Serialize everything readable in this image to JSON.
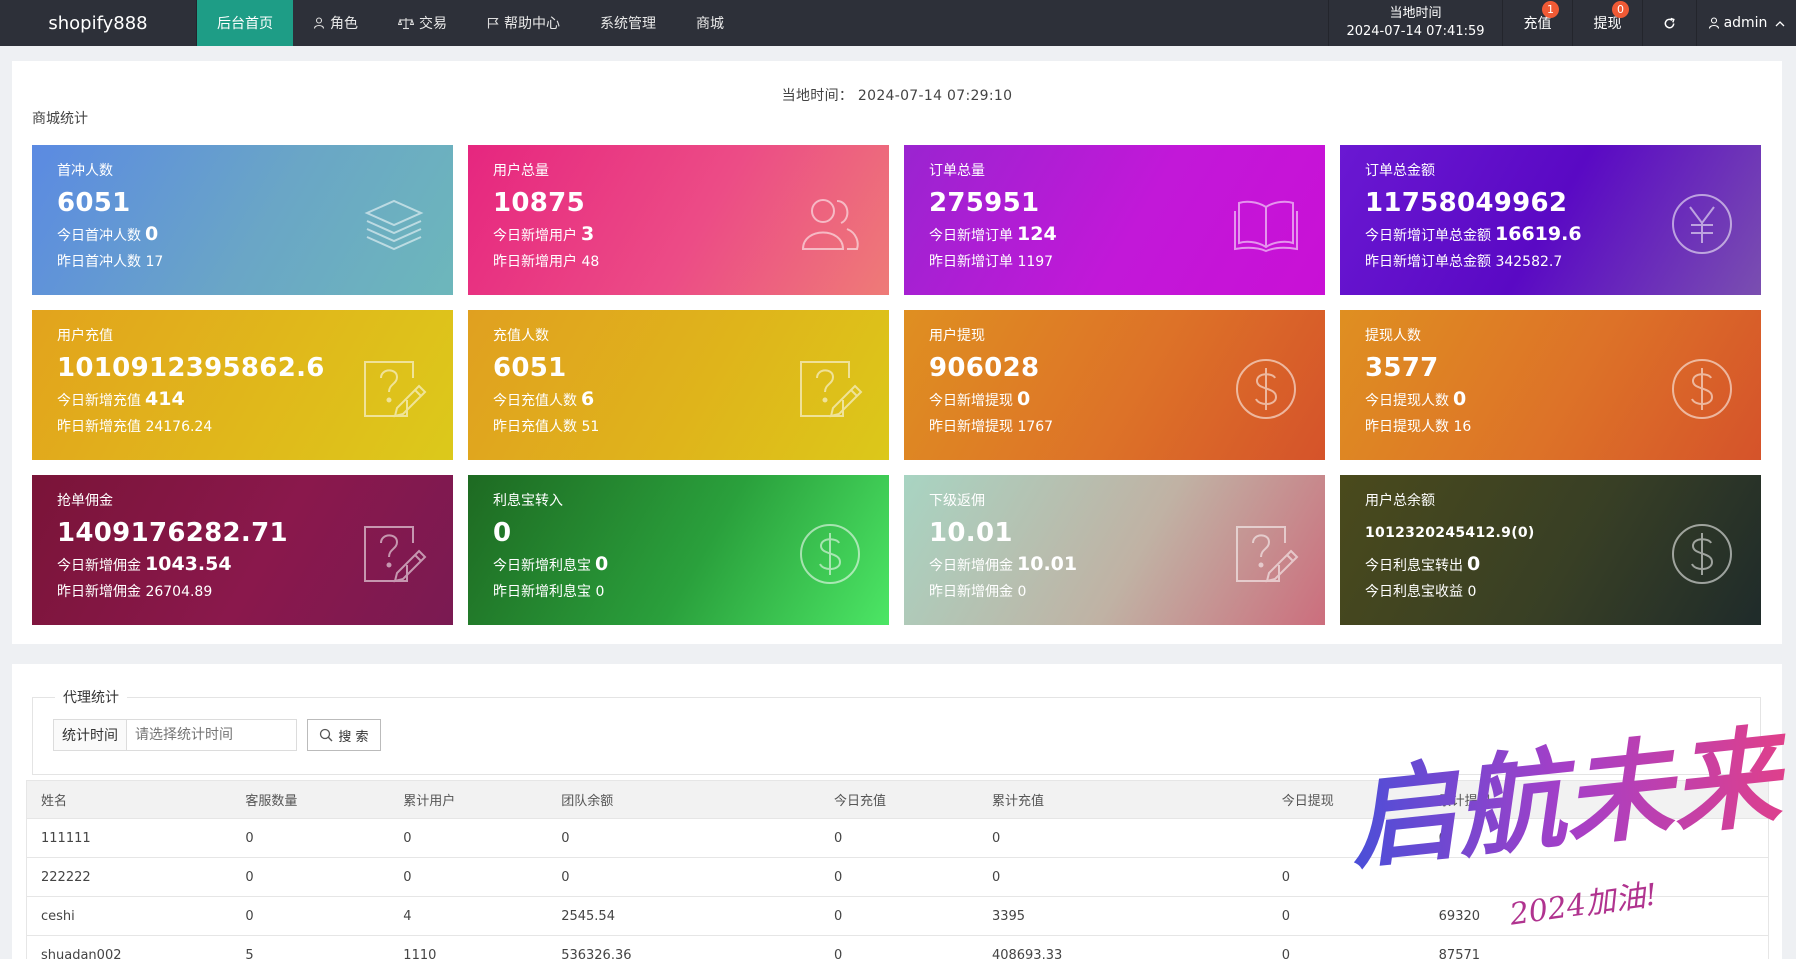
{
  "topbar": {
    "brand": "shopify888",
    "nav": [
      {
        "label": "后台首页",
        "icon": "none",
        "active": true
      },
      {
        "label": "角色",
        "icon": "user-icon",
        "active": false
      },
      {
        "label": "交易",
        "icon": "scale-icon",
        "active": false
      },
      {
        "label": "帮助中心",
        "icon": "flag-icon",
        "active": false
      },
      {
        "label": "系统管理",
        "icon": "none",
        "active": false
      },
      {
        "label": "商城",
        "icon": "none",
        "active": false
      }
    ],
    "time_title": "当地时间",
    "time_value": "2024-07-14 07:41:59",
    "recharge_label": "充值",
    "recharge_badge": "1",
    "withdraw_label": "提现",
    "withdraw_badge": "0",
    "refresh_icon": "refresh-icon",
    "user_label": "admin",
    "colors": {
      "bar": "#2d3039",
      "active": "#1e9d86",
      "badge": "#f05a35"
    }
  },
  "stats": {
    "local_time": "当地时间： 2024-07-14 07:29:10",
    "section_title": "商城统计",
    "cards": [
      {
        "title": "首冲人数",
        "value": "6051",
        "line2_label": "今日首冲人数",
        "line2_value": "0",
        "line3": "昨日首冲人数 17",
        "icon": "layers-icon"
      },
      {
        "title": "用户总量",
        "value": "10875",
        "line2_label": "今日新增用户",
        "line2_value": "3",
        "line3": "昨日新增用户 48",
        "icon": "users-icon"
      },
      {
        "title": "订单总量",
        "value": "275951",
        "line2_label": "今日新增订单",
        "line2_value": "124",
        "line3": "昨日新增订单 1197",
        "icon": "book-icon"
      },
      {
        "title": "订单总金额",
        "value": "11758049962",
        "line2_label": "今日新增订单总金额",
        "line2_value": "16619.6",
        "line3": "昨日新增订单总金额 342582.7",
        "icon": "yen-icon"
      },
      {
        "title": "用户充值",
        "value": "1010912395862.6",
        "line2_label": "今日新增充值",
        "line2_value": "414",
        "line3": "昨日新增充值 24176.24",
        "icon": "question-edit-icon"
      },
      {
        "title": "充值人数",
        "value": "6051",
        "line2_label": "今日充值人数",
        "line2_value": "6",
        "line3": "昨日充值人数 51",
        "icon": "question-edit-icon"
      },
      {
        "title": "用户提现",
        "value": "906028",
        "line2_label": "今日新增提现",
        "line2_value": "0",
        "line3": "昨日新增提现 1767",
        "icon": "dollar-icon"
      },
      {
        "title": "提现人数",
        "value": "3577",
        "line2_label": "今日提现人数",
        "line2_value": "0",
        "line3": "昨日提现人数 16",
        "icon": "dollar-icon"
      },
      {
        "title": "抢单佣金",
        "value": "1409176282.71",
        "line2_label": "今日新增佣金",
        "line2_value": "1043.54",
        "line3": "昨日新增佣金 26704.89",
        "icon": "question-edit-icon"
      },
      {
        "title": "利息宝转入",
        "value": "0",
        "line2_label": "今日新增利息宝",
        "line2_value": "0",
        "line3": "昨日新增利息宝 0",
        "icon": "dollar-icon"
      },
      {
        "title": "下级返佣",
        "value": "10.01",
        "line2_label": "今日新增佣金",
        "line2_value": "10.01",
        "line3": "昨日新增佣金 0",
        "icon": "question-edit-icon"
      },
      {
        "title": "用户总余额",
        "value": "1012320245412.9(0)",
        "line2_label": "今日利息宝转出",
        "line2_value": "0",
        "line3": "今日利息宝收益 0",
        "icon": "dollar-icon"
      }
    ]
  },
  "agent": {
    "legend": "代理统计",
    "filter_label": "统计时间",
    "filter_placeholder": "请选择统计时间",
    "search_label": "搜 索",
    "columns": [
      "姓名",
      "客服数量",
      "累计用户",
      "团队余额",
      "今日充值",
      "累计充值",
      "今日提现",
      "累计提现"
    ],
    "rows": [
      [
        "111111",
        "0",
        "0",
        "0",
        "0",
        "0",
        "",
        "0"
      ],
      [
        "222222",
        "0",
        "0",
        "0",
        "0",
        "0",
        "0",
        ""
      ],
      [
        "ceshi",
        "0",
        "4",
        "2545.54",
        "0",
        "3395",
        "0",
        "69320"
      ],
      [
        "shuadan002",
        "5",
        "1110",
        "536326.36",
        "0",
        "408693.33",
        "0",
        "87571"
      ]
    ]
  },
  "watermark": {
    "text": "启航未来",
    "subtext": "2024加油!"
  }
}
